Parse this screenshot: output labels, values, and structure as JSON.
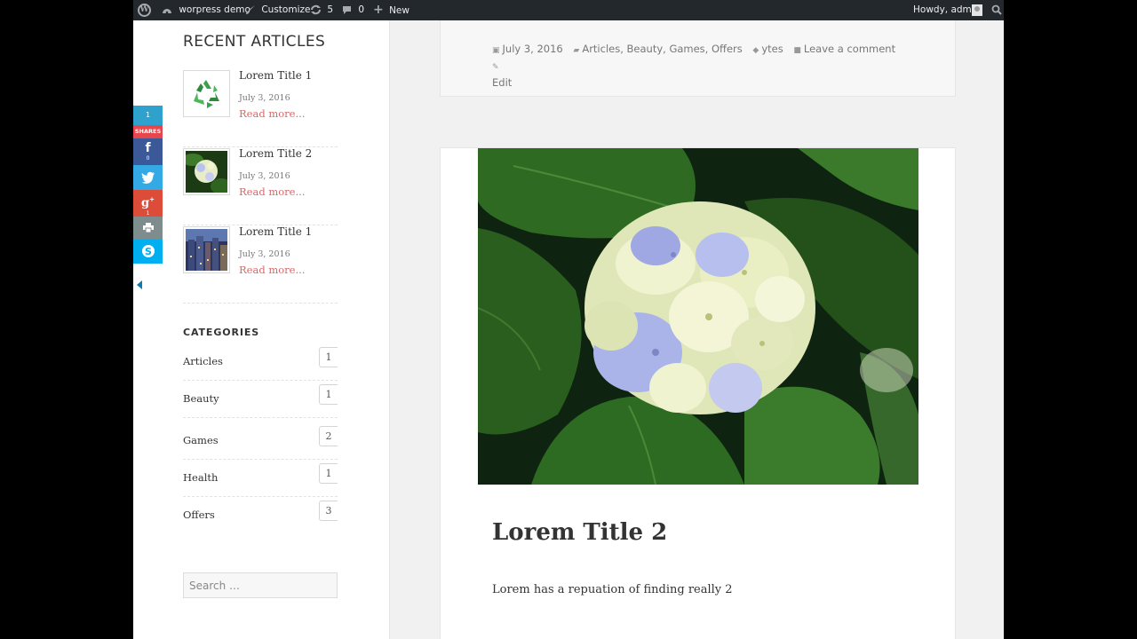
{
  "adminbar": {
    "site_name": "worpress demo",
    "customize": "Customize",
    "updates_count": "5",
    "comments_count": "0",
    "new_label": "New",
    "howdy": "Howdy, admin"
  },
  "sharebar": {
    "shares_count": "1",
    "shares_label": "SHARES",
    "facebook_count": "0",
    "googleplus_count": "1"
  },
  "recent_articles": {
    "title": "RECENT ARTICLES",
    "items": [
      {
        "title": "Lorem Title 1",
        "date": "July 3, 2016",
        "more": "Read more..."
      },
      {
        "title": "Lorem Title 2",
        "date": "July 3, 2016",
        "more": "Read more..."
      },
      {
        "title": "Lorem Title 1",
        "date": "July 3, 2016",
        "more": "Read more..."
      }
    ]
  },
  "categories": {
    "title": "CATEGORIES",
    "items": [
      {
        "name": "Articles",
        "count": "1"
      },
      {
        "name": "Beauty",
        "count": "1"
      },
      {
        "name": "Games",
        "count": "2"
      },
      {
        "name": "Health",
        "count": "1"
      },
      {
        "name": "Offers",
        "count": "3"
      }
    ]
  },
  "search": {
    "placeholder": "Search …"
  },
  "prev_post_meta": {
    "date": "July 3, 2016",
    "categories": "Articles, Beauty, Games, Offers",
    "tag": "ytes",
    "comment": "Leave a comment",
    "edit": "Edit"
  },
  "post": {
    "title": "Lorem Title 2",
    "excerpt": "Lorem has a repuation of finding really 2"
  },
  "colors": {
    "adminbar_bg": "#23282d",
    "link_accent": "#d66969",
    "page_bg": "#f1f1f1",
    "share_count": "#2ea2cc",
    "share_label": "#e5474d",
    "facebook": "#3b5998",
    "twitter": "#33a9e6",
    "googleplus": "#dd4b39",
    "print": "#7e8c8d",
    "skype": "#00aff0"
  },
  "icons": [
    "wordpress-logo-icon",
    "dashboard-icon",
    "brush-icon",
    "updates-icon",
    "comment-bubble-icon",
    "plus-icon",
    "avatar-icon",
    "search-icon",
    "facebook-icon",
    "twitter-icon",
    "google-plus-icon",
    "print-icon",
    "skype-icon",
    "collapse-arrow-icon",
    "calendar-icon",
    "folder-icon",
    "tag-icon",
    "comment-icon",
    "pencil-icon"
  ]
}
